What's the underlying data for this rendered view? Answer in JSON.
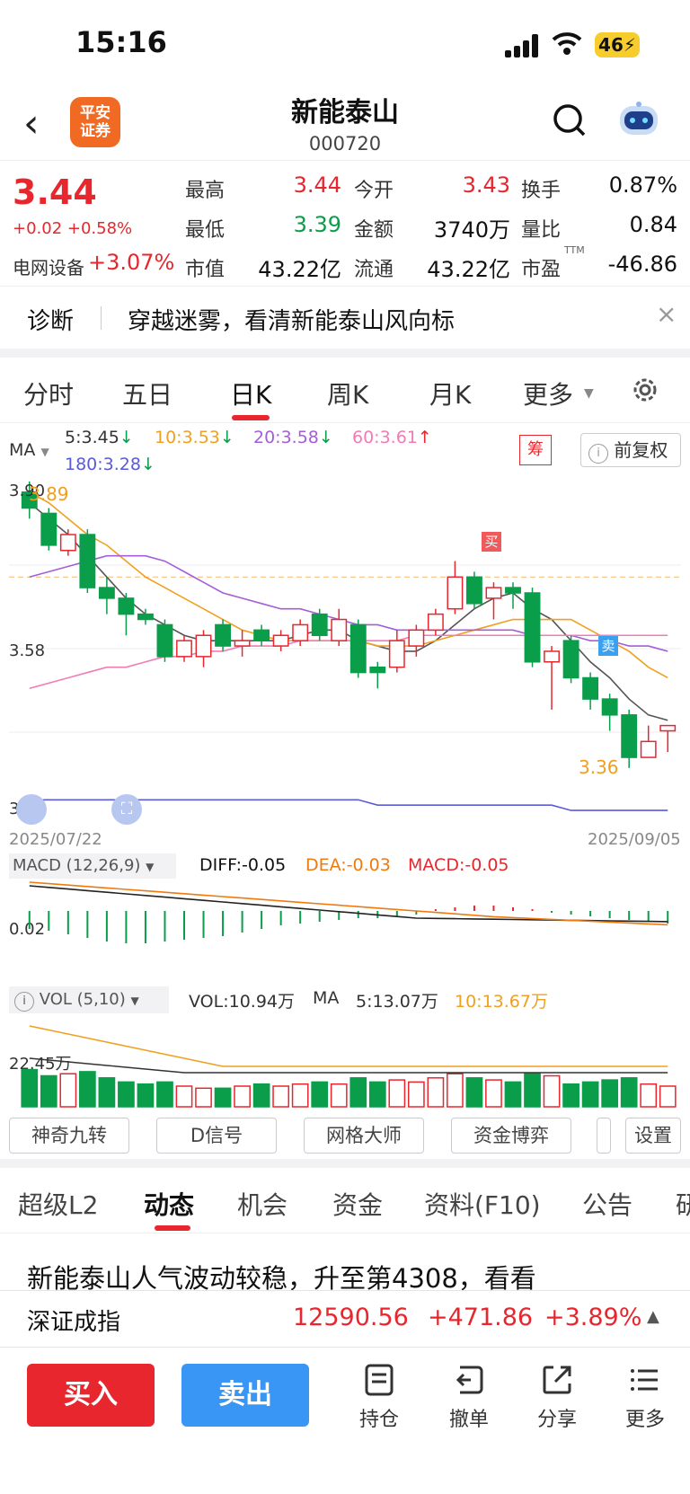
{
  "status": {
    "time": "15:16",
    "battery": "46"
  },
  "header": {
    "broker_logo_line1": "平安",
    "broker_logo_line2": "证券",
    "name": "新能泰山",
    "code": "000720"
  },
  "quote": {
    "price": "3.44",
    "change": "+0.02 +0.58%",
    "sector": "电网设备",
    "sector_change": "+3.07%",
    "high_label": "最高",
    "high": "3.44",
    "open_label": "今开",
    "open": "3.43",
    "turnover_label": "换手",
    "turnover": "0.87%",
    "low_label": "最低",
    "low": "3.39",
    "amount_label": "金额",
    "amount": "3740万",
    "volratio_label": "量比",
    "volratio": "0.84",
    "mktcap_label": "市值",
    "mktcap": "43.22亿",
    "float_label": "流通",
    "float": "43.22亿",
    "pe_label": "市盈",
    "pe_sup": "TTM",
    "pe": "-46.86"
  },
  "diagnosis": {
    "label": "诊断",
    "text": "穿越迷雾，看清新能泰山风向标",
    "close": "×"
  },
  "chart_tabs": [
    "分时",
    "五日",
    "日K",
    "周K",
    "月K",
    "更多"
  ],
  "ma_legend": {
    "label": "MA",
    "ma5": "5:3.45",
    "ma10": "10:3.53",
    "ma20": "20:3.58",
    "ma60": "60:3.61",
    "ma180": "180:3.28",
    "chip_btn": "筹",
    "adjust_btn": "前复权",
    "arrow_down": "↓",
    "arrow_up": "↑"
  },
  "kline": {
    "axis_labels": {
      "top": "3.90",
      "mid": "3.58",
      "bottom": "3.27"
    },
    "date_start": "2025/07/22",
    "date_end": "2025/09/05",
    "high_mark": "3.89",
    "low_mark": "3.36",
    "buy_mark": "买",
    "sell_mark": "卖"
  },
  "macd": {
    "label": "MACD (12,26,9)",
    "diff": "DIFF:-0.05",
    "dea": "DEA:-0.03",
    "macd": "MACD:-0.05",
    "axis": "0.02"
  },
  "vol": {
    "label": "VOL (5,10)",
    "vol": "VOL:10.94万",
    "ma_label": "MA",
    "ma5": "5:13.07万",
    "ma10": "10:13.67万",
    "axis": "22.45万"
  },
  "tools": [
    "神奇九转",
    "D信号",
    "网格大师",
    "资金博弈",
    "设置"
  ],
  "bottom_tabs": [
    "超级L2",
    "动态",
    "机会",
    "资金",
    "资料(F10)",
    "公告",
    "研"
  ],
  "news": {
    "headline": "新能泰山人气波动较稳，升至第4308，看看"
  },
  "index_bar": {
    "name": "深证成指",
    "value": "12590.56",
    "change": "+471.86",
    "pct": "+3.89%"
  },
  "actions": {
    "buy": "买入",
    "sell": "卖出",
    "hold": "持仓",
    "cancel": "撤单",
    "share": "分享",
    "more": "更多"
  },
  "chart_data": {
    "type": "candlestick",
    "title": "",
    "x_range": [
      "2025/07/22",
      "2025/09/05"
    ],
    "ylim": [
      3.27,
      3.9
    ],
    "candles": [
      {
        "o": 3.88,
        "c": 3.85,
        "h": 3.9,
        "l": 3.83
      },
      {
        "o": 3.84,
        "c": 3.78,
        "h": 3.85,
        "l": 3.77
      },
      {
        "o": 3.77,
        "c": 3.8,
        "h": 3.81,
        "l": 3.76
      },
      {
        "o": 3.8,
        "c": 3.7,
        "h": 3.81,
        "l": 3.69
      },
      {
        "o": 3.7,
        "c": 3.68,
        "h": 3.72,
        "l": 3.65
      },
      {
        "o": 3.68,
        "c": 3.65,
        "h": 3.69,
        "l": 3.61
      },
      {
        "o": 3.65,
        "c": 3.64,
        "h": 3.66,
        "l": 3.63
      },
      {
        "o": 3.63,
        "c": 3.57,
        "h": 3.64,
        "l": 3.56
      },
      {
        "o": 3.57,
        "c": 3.6,
        "h": 3.61,
        "l": 3.56
      },
      {
        "o": 3.57,
        "c": 3.61,
        "h": 3.62,
        "l": 3.55
      },
      {
        "o": 3.63,
        "c": 3.59,
        "h": 3.64,
        "l": 3.58
      },
      {
        "o": 3.59,
        "c": 3.6,
        "h": 3.62,
        "l": 3.57
      },
      {
        "o": 3.62,
        "c": 3.6,
        "h": 3.63,
        "l": 3.59
      },
      {
        "o": 3.59,
        "c": 3.61,
        "h": 3.62,
        "l": 3.58
      },
      {
        "o": 3.6,
        "c": 3.63,
        "h": 3.64,
        "l": 3.59
      },
      {
        "o": 3.65,
        "c": 3.61,
        "h": 3.66,
        "l": 3.6
      },
      {
        "o": 3.6,
        "c": 3.64,
        "h": 3.66,
        "l": 3.59
      },
      {
        "o": 3.63,
        "c": 3.54,
        "h": 3.64,
        "l": 3.53
      },
      {
        "o": 3.55,
        "c": 3.54,
        "h": 3.56,
        "l": 3.51
      },
      {
        "o": 3.55,
        "c": 3.6,
        "h": 3.62,
        "l": 3.54
      },
      {
        "o": 3.59,
        "c": 3.62,
        "h": 3.63,
        "l": 3.57
      },
      {
        "o": 3.62,
        "c": 3.65,
        "h": 3.66,
        "l": 3.61
      },
      {
        "o": 3.66,
        "c": 3.72,
        "h": 3.75,
        "l": 3.65
      },
      {
        "o": 3.72,
        "c": 3.67,
        "h": 3.73,
        "l": 3.66
      },
      {
        "o": 3.68,
        "c": 3.7,
        "h": 3.71,
        "l": 3.64
      },
      {
        "o": 3.7,
        "c": 3.69,
        "h": 3.71,
        "l": 3.66
      },
      {
        "o": 3.69,
        "c": 3.56,
        "h": 3.7,
        "l": 3.55
      },
      {
        "o": 3.56,
        "c": 3.58,
        "h": 3.59,
        "l": 3.47
      },
      {
        "o": 3.6,
        "c": 3.53,
        "h": 3.61,
        "l": 3.52
      },
      {
        "o": 3.53,
        "c": 3.49,
        "h": 3.54,
        "l": 3.47
      },
      {
        "o": 3.49,
        "c": 3.46,
        "h": 3.5,
        "l": 3.43
      },
      {
        "o": 3.46,
        "c": 3.38,
        "h": 3.47,
        "l": 3.36
      },
      {
        "o": 3.38,
        "c": 3.41,
        "h": 3.44,
        "l": 3.38
      },
      {
        "o": 3.43,
        "c": 3.44,
        "h": 3.44,
        "l": 3.39
      }
    ],
    "series": [
      {
        "name": "MA5",
        "values": [
          3.86,
          3.83,
          3.8,
          3.76,
          3.72,
          3.68,
          3.65,
          3.63,
          3.61,
          3.6,
          3.6,
          3.6,
          3.6,
          3.6,
          3.61,
          3.62,
          3.62,
          3.6,
          3.59,
          3.58,
          3.58,
          3.6,
          3.63,
          3.66,
          3.68,
          3.69,
          3.66,
          3.64,
          3.6,
          3.56,
          3.53,
          3.49,
          3.46,
          3.45
        ]
      },
      {
        "name": "MA10",
        "values": [
          3.88,
          3.86,
          3.83,
          3.8,
          3.78,
          3.75,
          3.72,
          3.7,
          3.68,
          3.66,
          3.64,
          3.62,
          3.61,
          3.6,
          3.6,
          3.6,
          3.6,
          3.6,
          3.59,
          3.59,
          3.59,
          3.6,
          3.61,
          3.62,
          3.63,
          3.64,
          3.64,
          3.64,
          3.64,
          3.62,
          3.6,
          3.58,
          3.55,
          3.53
        ]
      },
      {
        "name": "MA20",
        "values": [
          3.72,
          3.73,
          3.74,
          3.75,
          3.76,
          3.76,
          3.76,
          3.75,
          3.73,
          3.71,
          3.69,
          3.68,
          3.67,
          3.66,
          3.66,
          3.65,
          3.64,
          3.63,
          3.63,
          3.62,
          3.62,
          3.62,
          3.62,
          3.62,
          3.62,
          3.62,
          3.61,
          3.61,
          3.61,
          3.6,
          3.6,
          3.59,
          3.59,
          3.58
        ]
      },
      {
        "name": "MA60",
        "values": [
          3.51,
          3.52,
          3.53,
          3.54,
          3.55,
          3.55,
          3.56,
          3.57,
          3.57,
          3.58,
          3.58,
          3.59,
          3.59,
          3.59,
          3.6,
          3.6,
          3.6,
          3.6,
          3.6,
          3.6,
          3.61,
          3.61,
          3.61,
          3.61,
          3.61,
          3.61,
          3.61,
          3.61,
          3.61,
          3.61,
          3.61,
          3.61,
          3.61,
          3.61
        ]
      },
      {
        "name": "MA180",
        "values": [
          3.3,
          3.3,
          3.3,
          3.3,
          3.3,
          3.3,
          3.3,
          3.3,
          3.3,
          3.3,
          3.3,
          3.3,
          3.3,
          3.3,
          3.3,
          3.3,
          3.3,
          3.3,
          3.29,
          3.29,
          3.29,
          3.29,
          3.29,
          3.29,
          3.29,
          3.29,
          3.29,
          3.29,
          3.28,
          3.28,
          3.28,
          3.28,
          3.28,
          3.28
        ]
      }
    ]
  }
}
